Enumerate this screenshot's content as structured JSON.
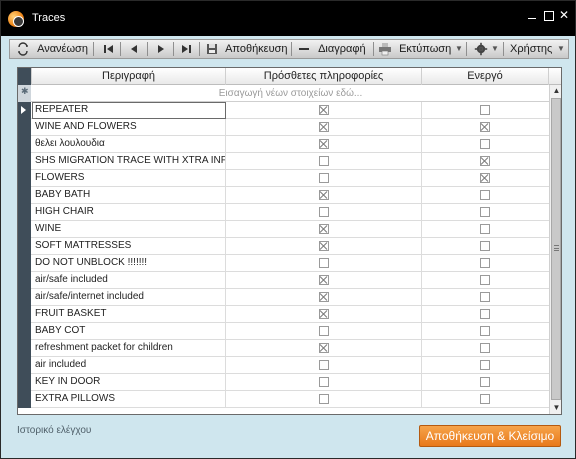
{
  "window": {
    "title": "Traces"
  },
  "toolbar": {
    "refresh_label": "Ανανέωση",
    "save_label": "Αποθήκευση",
    "delete_label": "Διαγραφή",
    "print_label": "Εκτύπωση",
    "users_label": "Χρήστης"
  },
  "grid": {
    "columns": [
      "Περιγραφή",
      "Πρόσθετες πληροφορίες",
      "Ενεργό"
    ],
    "new_row_placeholder": "Εισαγωγή νέων στοιχείων εδώ...",
    "rows": [
      {
        "description": "REPEATER",
        "additional_info": true,
        "active": false
      },
      {
        "description": "WINE AND FLOWERS",
        "additional_info": true,
        "active": true
      },
      {
        "description": "θελει λουλουδια",
        "additional_info": true,
        "active": false
      },
      {
        "description": "SHS MIGRATION TRACE WITH XTRA INFO",
        "additional_info": false,
        "active": true
      },
      {
        "description": "FLOWERS",
        "additional_info": false,
        "active": true
      },
      {
        "description": "BABY BATH",
        "additional_info": true,
        "active": false
      },
      {
        "description": "HIGH CHAIR",
        "additional_info": false,
        "active": false
      },
      {
        "description": "WINE",
        "additional_info": true,
        "active": false
      },
      {
        "description": "SOFT MATTRESSES",
        "additional_info": true,
        "active": false
      },
      {
        "description": "DO NOT UNBLOCK !!!!!!!",
        "additional_info": false,
        "active": false
      },
      {
        "description": "air/safe included",
        "additional_info": true,
        "active": false
      },
      {
        "description": "air/safe/internet included",
        "additional_info": true,
        "active": false
      },
      {
        "description": "FRUIT BASKET",
        "additional_info": true,
        "active": false
      },
      {
        "description": "BABY COT",
        "additional_info": false,
        "active": false
      },
      {
        "description": "refreshment packet for children",
        "additional_info": true,
        "active": false
      },
      {
        "description": "air included",
        "additional_info": false,
        "active": false
      },
      {
        "description": "KEY IN DOOR",
        "additional_info": false,
        "active": false
      },
      {
        "description": "EXTRA PILLOWS",
        "additional_info": false,
        "active": false
      }
    ]
  },
  "footer": {
    "audit_label": "Ιστορικό ελέγχου",
    "save_close_label": "Αποθήκευση & Κλείσιμο"
  },
  "colors": {
    "titlebar": "#000000",
    "window_bg": "#cfe6ee",
    "accent": "#e8791a",
    "indicator": "#3f4d59"
  }
}
